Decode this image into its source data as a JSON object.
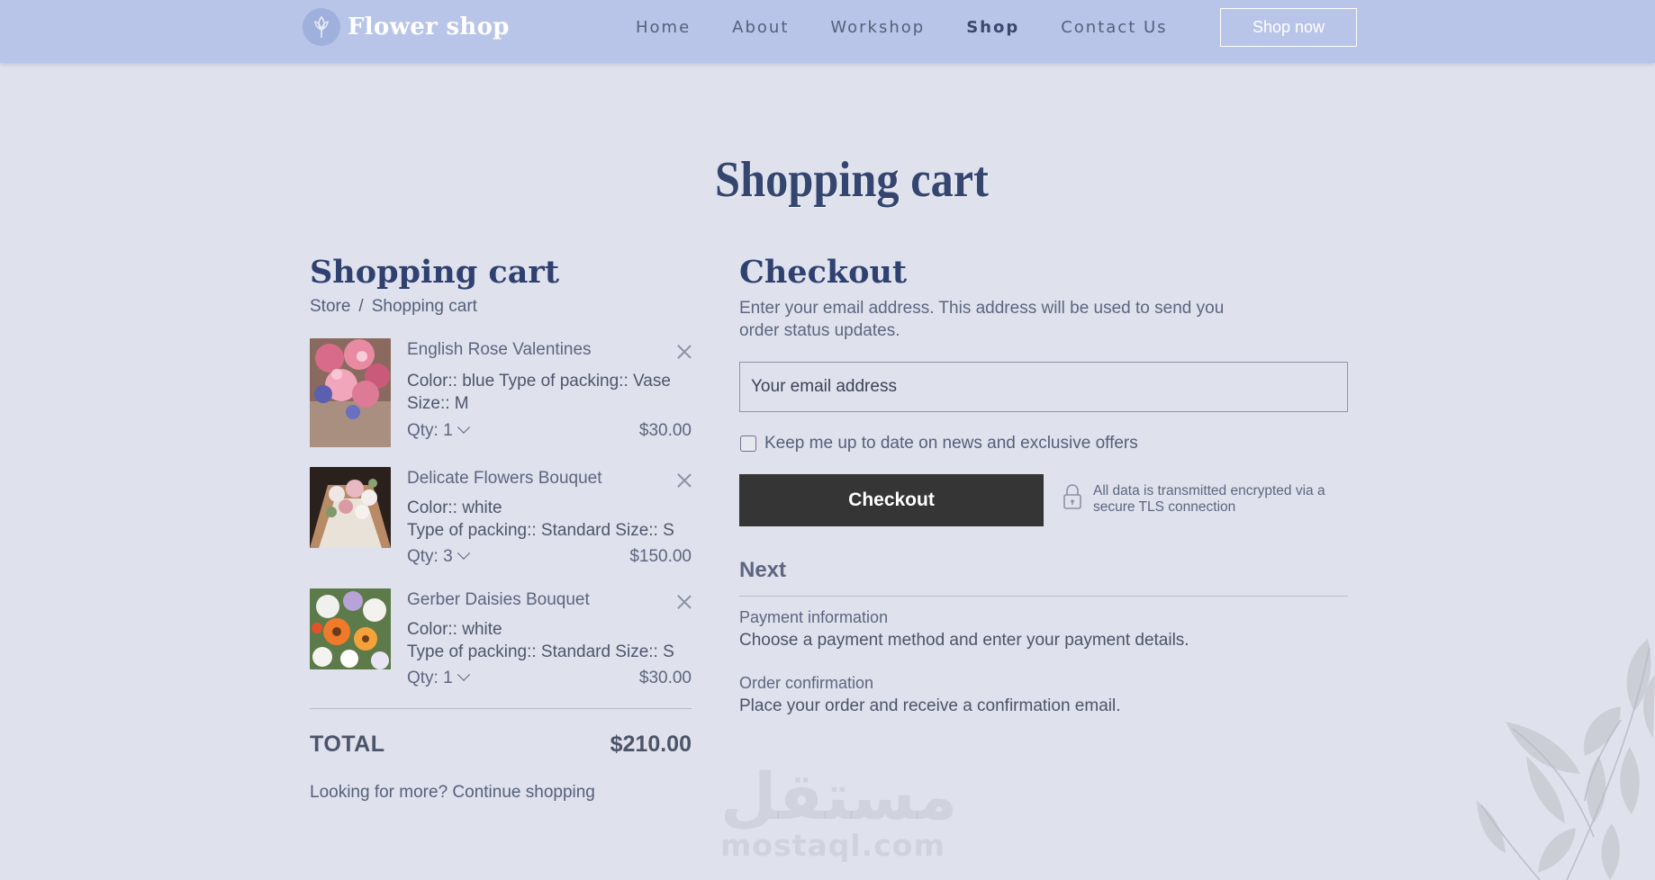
{
  "header": {
    "logo_text": "Flower shop",
    "nav": [
      {
        "label": "Home",
        "active": false
      },
      {
        "label": "About",
        "active": false
      },
      {
        "label": "Workshop",
        "active": false
      },
      {
        "label": "Shop",
        "active": true
      },
      {
        "label": "Contact Us",
        "active": false
      }
    ],
    "cta_label": "Shop now"
  },
  "page_title": "Shopping cart",
  "cart": {
    "title": "Shopping cart",
    "breadcrumb": [
      "Store",
      "Shopping cart"
    ],
    "breadcrumb_sep": "/",
    "items": [
      {
        "name": "English Rose Valentines",
        "details": [
          "Color:: blue  Type of packing:: Vase",
          "Size:: M"
        ],
        "qty": "Qty: 1",
        "price": "$30.00"
      },
      {
        "name": "Delicate Flowers Bouquet",
        "details": [
          "Color:: white",
          "Type of packing:: Standard  Size:: S"
        ],
        "qty": "Qty: 3",
        "price": "$150.00"
      },
      {
        "name": "Gerber Daisies Bouquet",
        "details": [
          "Color:: white",
          "Type of packing:: Standard  Size:: S"
        ],
        "qty": "Qty: 1",
        "price": "$30.00"
      }
    ],
    "total_label": "TOTAL",
    "total_value": "$210.00",
    "continue_text": "Looking for more? Continue shopping"
  },
  "checkout": {
    "title": "Checkout",
    "description": "Enter your email address. This address will be used to send you order status updates.",
    "email_placeholder": "Your email address",
    "newsletter_label": "Keep me up to date on news and exclusive offers",
    "newsletter_checked": false,
    "button_label": "Checkout",
    "secure_text": "All data is transmitted encrypted via a secure TLS connection",
    "next_title": "Next",
    "steps": [
      {
        "title": "Payment information",
        "desc": "Choose a payment method and enter your payment details."
      },
      {
        "title": "Order confirmation",
        "desc": "Place your order and receive a confirmation email."
      }
    ]
  },
  "watermark": {
    "arabic": "مستقل",
    "latin": "mostaql.com"
  },
  "colors": {
    "header_bg": "#b9c5e8",
    "page_bg": "#dfe1ec",
    "heading": "#2f4170",
    "button_dark": "#353535"
  }
}
